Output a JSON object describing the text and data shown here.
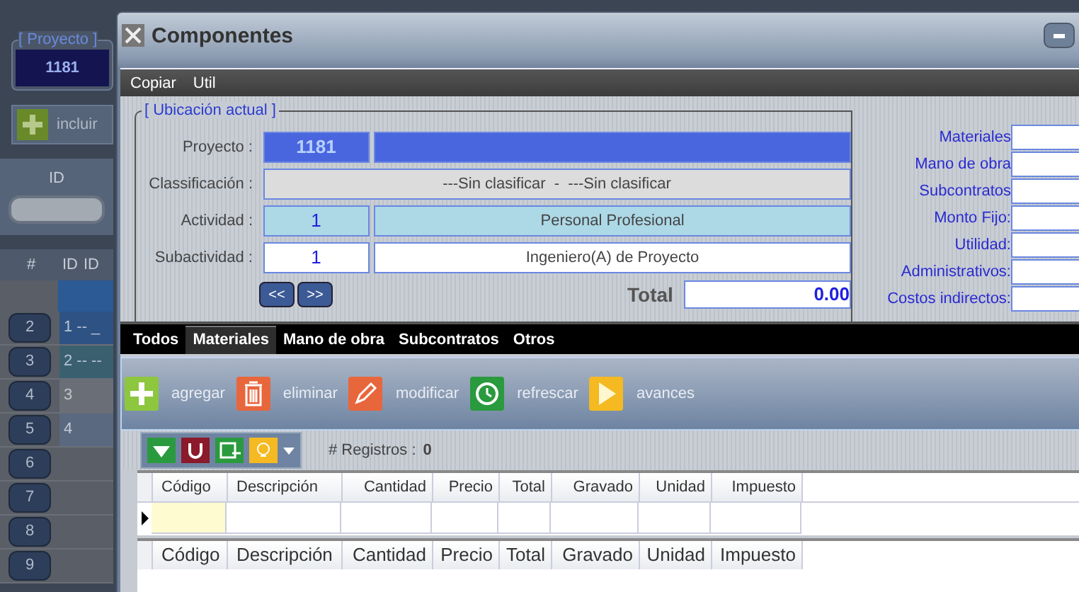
{
  "background": {
    "project_legend": "[ Proyecto ]",
    "project_id": "1181",
    "include_button": "incluir",
    "id_label": "ID",
    "table": {
      "columns": [
        "#",
        "ID",
        "ID"
      ],
      "rows": [
        {
          "num": "2",
          "id": "1 -- _"
        },
        {
          "num": "3",
          "id": "2 -- --"
        },
        {
          "num": "4",
          "id": "3"
        },
        {
          "num": "5",
          "id": "4"
        },
        {
          "num": "6",
          "id": ""
        },
        {
          "num": "7",
          "id": ""
        },
        {
          "num": "8",
          "id": ""
        },
        {
          "num": "9",
          "id": ""
        }
      ]
    }
  },
  "dialog": {
    "title": "Componentes",
    "menu": [
      "Copiar",
      "Util"
    ],
    "location": {
      "legend": "[ Ubicación actual ]",
      "fields": [
        {
          "kind": "project",
          "label": "Proyecto :",
          "code": "1181"
        },
        {
          "kind": "classification",
          "label": "Classificación :",
          "value": "---Sin clasificar  -  ---Sin clasificar"
        },
        {
          "kind": "activity",
          "label": "Actividad :",
          "code": "1",
          "description": "Personal Profesional"
        },
        {
          "kind": "subactivity",
          "label": "Subactividad :",
          "code": "1",
          "description": "Ingeniero(A) de Proyecto"
        }
      ],
      "nav": [
        "<<",
        ">>"
      ],
      "total_label": "Total",
      "total": "0.00"
    },
    "costs": [
      "Materiales",
      "Mano de obra",
      "Subcontratos",
      "Monto Fijo:",
      "Utilidad:",
      "Administrativos:",
      "Costos indirectos:"
    ],
    "tabs": [
      {
        "label": "Todos",
        "selected": false
      },
      {
        "label": "Materiales",
        "selected": true
      },
      {
        "label": "Mano de obra",
        "selected": false
      },
      {
        "label": "Subcontratos",
        "selected": false
      },
      {
        "label": "Otros",
        "selected": false
      }
    ],
    "actions": [
      {
        "kind": "add",
        "label": "agregar"
      },
      {
        "kind": "delete",
        "label": "eliminar"
      },
      {
        "kind": "edit",
        "label": "modificar"
      },
      {
        "kind": "refresh",
        "label": "refrescar"
      },
      {
        "kind": "play",
        "label": "avances"
      }
    ],
    "records_label": "# Registros :",
    "records": "0",
    "columns": [
      "Código",
      "Descripción",
      "Cantidad",
      "Precio",
      "Total",
      "Gravado",
      "Unidad",
      "Impuesto"
    ],
    "footer_columns": [
      "Código",
      "Descripción",
      "Cantidad",
      "Precio",
      "Total",
      "Gravado",
      "Unidad",
      "Impuesto"
    ]
  }
}
